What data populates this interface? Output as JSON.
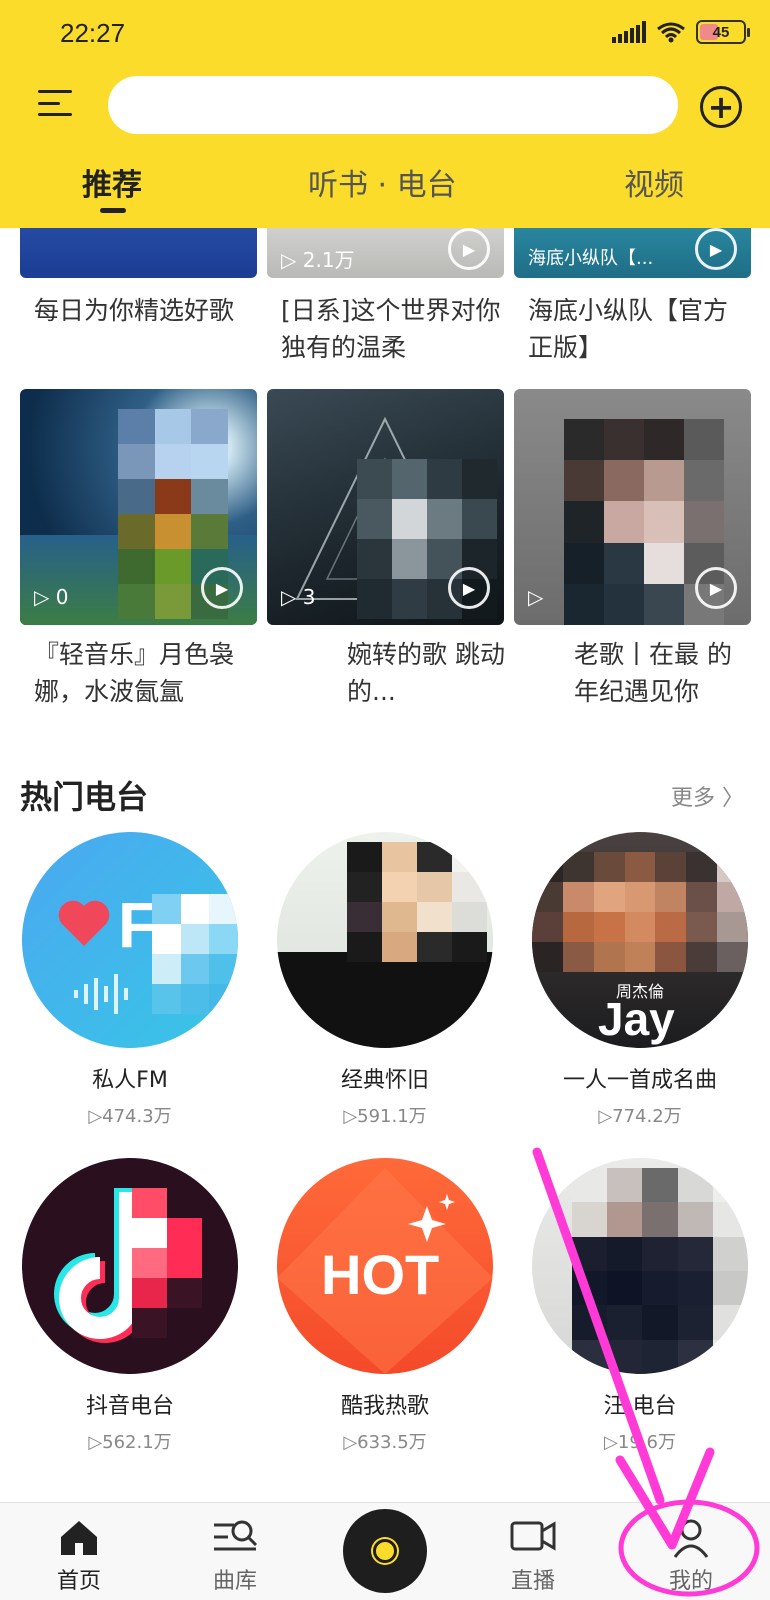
{
  "status_bar": {
    "time": "22:27",
    "battery": "45"
  },
  "header": {
    "menu_icon": "hamburger-icon",
    "add_icon": "plus-circle-icon",
    "search_placeholder": ""
  },
  "tabs": [
    {
      "label": "推荐",
      "active": true
    },
    {
      "label": "听书 · 电台",
      "active": false
    },
    {
      "label": "视频",
      "active": false
    }
  ],
  "playlists": [
    {
      "title": "每日为你精选好歌",
      "play_count": ""
    },
    {
      "title": "[日系]这个世界对你独有的温柔",
      "play_count": "▷ 2.1万"
    },
    {
      "title": "海底小纵队【官方正版】",
      "play_count": "海底小纵队【..."
    },
    {
      "title": "『轻音乐』月色袅娜，水波氤氲",
      "play_count": "▷ 0"
    },
    {
      "title": "婉转的歌 跳动的...",
      "play_count": "▷ 3"
    },
    {
      "title": "老歌丨在最 的年纪遇见你",
      "play_count": "▷"
    }
  ],
  "radio_section": {
    "title": "热门电台",
    "more": "更多 〉"
  },
  "radios": [
    {
      "name": "私人FM",
      "count": "▷474.3万"
    },
    {
      "name": "经典怀旧",
      "count": "▷591.1万"
    },
    {
      "name": "一人一首成名曲",
      "count": "▷774.2万"
    },
    {
      "name": "抖音电台",
      "count": "▷562.1万"
    },
    {
      "name": "酷我热歌",
      "count": "▷633.5万"
    },
    {
      "name": "汪 电台",
      "count": "▷19 6万"
    }
  ],
  "radio_art": {
    "fm_logo": "F",
    "jay_text": "Jay",
    "jay_sub": "周杰倫",
    "hot_text": "HOT"
  },
  "bottom_nav": [
    {
      "label": "首页",
      "icon": "home-icon",
      "active": true
    },
    {
      "label": "曲库",
      "icon": "library-search-icon",
      "active": false
    },
    {
      "label": "",
      "icon": "vinyl-disc-icon",
      "active": false
    },
    {
      "label": "直播",
      "icon": "video-camera-icon",
      "active": false
    },
    {
      "label": "我的",
      "icon": "person-icon",
      "active": false
    }
  ],
  "colors": {
    "brand_yellow": "#fbdc2a",
    "annotation_magenta": "#ff3ad6"
  }
}
